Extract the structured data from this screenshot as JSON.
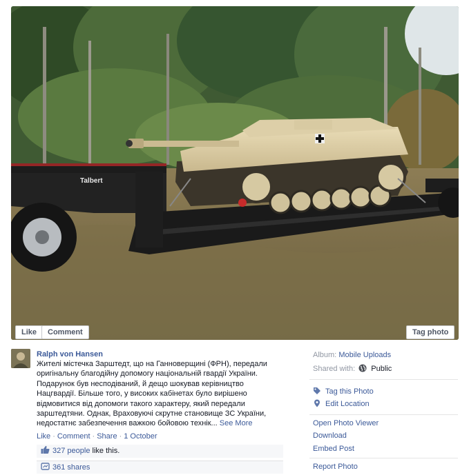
{
  "photo": {
    "truck_brand": "Talbert",
    "buttons": {
      "like": "Like",
      "comment": "Comment",
      "tag": "Tag photo"
    }
  },
  "post": {
    "author": "Ralph von Hansen",
    "text": "Жителі містечка Зарштедт, що на Ганноверщині (ФРН), передали оригінальну благодійну допомогу національній гвардії України. Подарунок був несподіваний, й дещо шокував керівництво Нацгвардії. Більше того, у високих кабінетах було вирішено відмовитися від допомоги такого характеру, який передали зарштедтяни. Однак, Враховуючі скрутне становище ЗС України, недостатнє забезпечення важкою бойовою технік...",
    "see_more": "See More",
    "actions": {
      "like": "Like",
      "comment": "Comment",
      "share": "Share",
      "separator": "·",
      "date": "1 October"
    },
    "likes": {
      "people_link": "327 people",
      "suffix": " like this."
    },
    "shares": "361 shares"
  },
  "sidebar": {
    "album_label": "Album:",
    "album_value": "Mobile Uploads",
    "shared_label": "Shared with:",
    "shared_value": "Public",
    "tag_this_photo": "Tag this Photo",
    "edit_location": "Edit Location",
    "open_photo_viewer": "Open Photo Viewer",
    "download": "Download",
    "embed_post": "Embed Post",
    "report_photo": "Report Photo"
  },
  "colors": {
    "link": "#3b5998",
    "text": "#141823",
    "muted": "#9197a3",
    "ufi_bg": "#f6f7f9"
  },
  "icons": {
    "like_count": "thumbs-up-icon",
    "shares": "share-icon",
    "public": "globe-icon",
    "tag": "tag-icon",
    "location": "location-pin-icon"
  }
}
